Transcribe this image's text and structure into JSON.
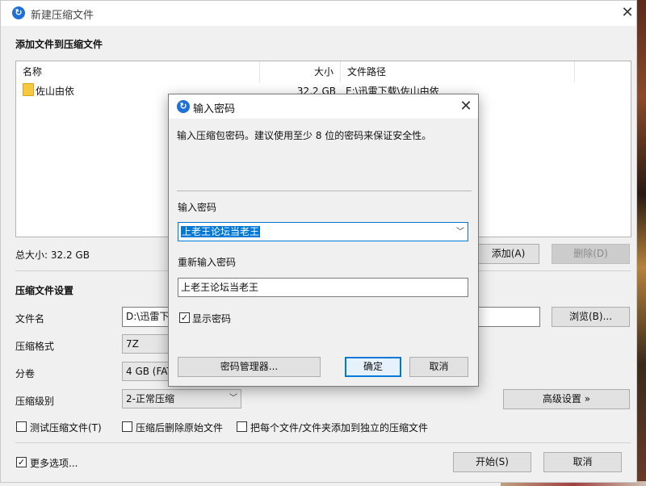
{
  "window": {
    "title": "新建压缩文件"
  },
  "add_section": {
    "title": "添加文件到压缩文件"
  },
  "file_list": {
    "columns": [
      "名称",
      "大小",
      "文件路径"
    ],
    "rows": [
      {
        "name": "佐山由依",
        "size": "32.2 GB",
        "path": "E:\\迅雷下载\\佐山由依"
      }
    ]
  },
  "total_size": "总大小: 32.2 GB",
  "buttons": {
    "add": "添加(A)",
    "delete": "删除(D)",
    "browse": "浏览(B)...",
    "advanced": "高级设置 »",
    "start": "开始(S)",
    "cancel": "取消"
  },
  "settings": {
    "title": "压缩文件设置",
    "filename_label": "文件名",
    "filename_value": "D:\\迅雷下",
    "format_label": "压缩格式",
    "format_value": "7Z",
    "split_label": "分卷",
    "split_value": "4 GB (FAT",
    "level_label": "压缩级别",
    "level_value": "2-正常压缩"
  },
  "options": {
    "test": "测试压缩文件(T)",
    "delete_after": "压缩后删除原始文件",
    "separate": "把每个文件/文件夹添加到独立的压缩文件",
    "more": "更多选项..."
  },
  "dialog": {
    "title": "输入密码",
    "description": "输入压缩包密码。建议使用至少 8 位的密码来保证安全性。",
    "password_label": "输入密码",
    "password_value": "上老王论坛当老王",
    "confirm_label": "重新输入密码",
    "confirm_value": "上老王论坛当老王",
    "show_password": "显示密码",
    "manager_button": "密码管理器...",
    "ok_button": "确定",
    "cancel_button": "取消"
  },
  "colors": {
    "accent": "#0078d7",
    "app_icon": "#1f6fd8",
    "folder": "#f5c842"
  }
}
